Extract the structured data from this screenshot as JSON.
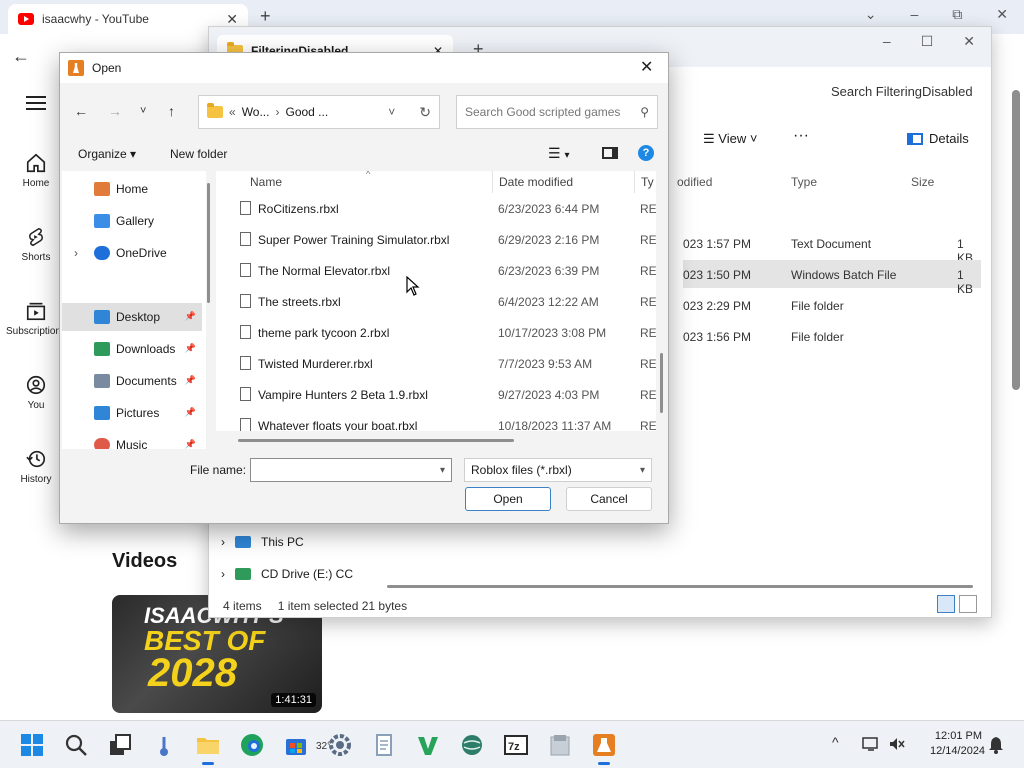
{
  "browser": {
    "tab_title": "isaacwhy - YouTube",
    "tab_close": "✕",
    "new_tab": "+",
    "win_controls": [
      "⌄",
      "–",
      "⧉",
      "✕"
    ],
    "back": "←",
    "sidebar": [
      {
        "label": "Home",
        "icon": "home-icon"
      },
      {
        "label": "Shorts",
        "icon": "shorts-icon"
      },
      {
        "label": "Subscriptions",
        "icon": "subscriptions-icon"
      },
      {
        "label": "You",
        "icon": "you-icon"
      },
      {
        "label": "History",
        "icon": "history-icon"
      }
    ],
    "videos_heading": "Videos",
    "video": {
      "thumb_line1": "ISAACWHY'S",
      "thumb_line2": "BEST OF",
      "thumb_line3": "2028",
      "duration": "1:41:31"
    }
  },
  "explorer": {
    "tab_title": "FilteringDisabled",
    "tab_close": "✕",
    "new_tab": "+",
    "win_controls": [
      "–",
      "☐",
      "✕"
    ],
    "search_text": "Search FilteringDisabled",
    "view_label": "View",
    "more_label": "···",
    "details_label": "Details",
    "columns": {
      "modified": "odified",
      "type": "Type",
      "size": "Size"
    },
    "rows": [
      {
        "date": "023 1:57 PM",
        "type": "Text Document",
        "size": "1 KB",
        "selected": false
      },
      {
        "date": "023 1:50 PM",
        "type": "Windows Batch File",
        "size": "1 KB",
        "selected": true
      },
      {
        "date": "023 2:29 PM",
        "type": "File folder",
        "size": "",
        "selected": false
      },
      {
        "date": "023 1:56 PM",
        "type": "File folder",
        "size": "",
        "selected": false
      }
    ],
    "nav_this_pc": "This PC",
    "nav_cd_drive": "CD Drive (E:) CC",
    "status_count": "4 items",
    "status_selected": "1 item selected  21 bytes"
  },
  "dialog": {
    "title": "Open",
    "close": "✕",
    "address": {
      "chevrons": "«",
      "seg1": "Wo...",
      "seg_sep": "›",
      "seg2": "Good ..."
    },
    "search_placeholder": "Search Good scripted games",
    "organize": "Organize ▾",
    "new_folder": "New folder",
    "help": "?",
    "sidebar": [
      {
        "label": "Home",
        "color": "#e07b39",
        "pinned": false,
        "selected": false
      },
      {
        "label": "Gallery",
        "color": "#3a8ee6",
        "pinned": false,
        "selected": false
      },
      {
        "label": "OneDrive",
        "color": "#1e6fd9",
        "pinned": false,
        "selected": false,
        "expand": "›"
      },
      {
        "label": "Desktop",
        "color": "#2f86d6",
        "pinned": true,
        "selected": true
      },
      {
        "label": "Downloads",
        "color": "#2e9b5a",
        "pinned": true,
        "selected": false
      },
      {
        "label": "Documents",
        "color": "#7a8aa0",
        "pinned": true,
        "selected": false
      },
      {
        "label": "Pictures",
        "color": "#2f86d6",
        "pinned": true,
        "selected": false
      },
      {
        "label": "Music",
        "color": "#e05a4a",
        "pinned": true,
        "selected": false
      }
    ],
    "columns": {
      "name": "Name",
      "date": "Date modified",
      "type": "Ty"
    },
    "files": [
      {
        "name": "RoCitizens.rbxl",
        "date": "6/23/2023 6:44 PM",
        "type": "RE"
      },
      {
        "name": "Super Power Training Simulator.rbxl",
        "date": "6/29/2023 2:16 PM",
        "type": "RE"
      },
      {
        "name": "The Normal Elevator.rbxl",
        "date": "6/23/2023 6:39 PM",
        "type": "RE"
      },
      {
        "name": "The streets.rbxl",
        "date": "6/4/2023 12:22 AM",
        "type": "RE"
      },
      {
        "name": "theme park tycoon 2.rbxl",
        "date": "10/17/2023 3:08 PM",
        "type": "RE"
      },
      {
        "name": "Twisted Murderer.rbxl",
        "date": "7/7/2023 9:53 AM",
        "type": "RE"
      },
      {
        "name": "Vampire Hunters 2 Beta 1.9.rbxl",
        "date": "9/27/2023 4:03 PM",
        "type": "RE"
      },
      {
        "name": "Whatever floats your boat.rbxl",
        "date": "10/18/2023 11:37 AM",
        "type": "RE"
      }
    ],
    "filename_label": "File name:",
    "filename_value": "",
    "filetype_value": "Roblox files (*.rbxl)",
    "open_button": "Open",
    "cancel_button": "Cancel"
  },
  "taskbar": {
    "weather": "32°",
    "time": "12:01 PM",
    "date": "12/14/2024",
    "tray_chevron": "^",
    "apps": [
      {
        "name": "start-icon",
        "color": "#1e88e5"
      },
      {
        "name": "search-icon",
        "color": "#333333"
      },
      {
        "name": "task-view-icon",
        "color": "#333333"
      },
      {
        "name": "weather-icon",
        "color": "#4a76c8"
      },
      {
        "name": "file-explorer-icon",
        "color": "#f5c242"
      },
      {
        "name": "edge-icon",
        "color": "#1fa35c"
      },
      {
        "name": "store-icon",
        "color": "#2a6fd6"
      },
      {
        "name": "settings-icon",
        "color": "#5a6b85"
      },
      {
        "name": "notepad-icon",
        "color": "#8aa0b8"
      },
      {
        "name": "visual-studio-icon",
        "color": "#27a35a"
      },
      {
        "name": "globe-app-icon",
        "color": "#2e7d6b"
      },
      {
        "name": "7zip-icon",
        "color": "#2b2b2b"
      },
      {
        "name": "archive-app-icon",
        "color": "#9aa4ae"
      },
      {
        "name": "roblox-studio-icon",
        "color": "#e67e22"
      }
    ]
  }
}
